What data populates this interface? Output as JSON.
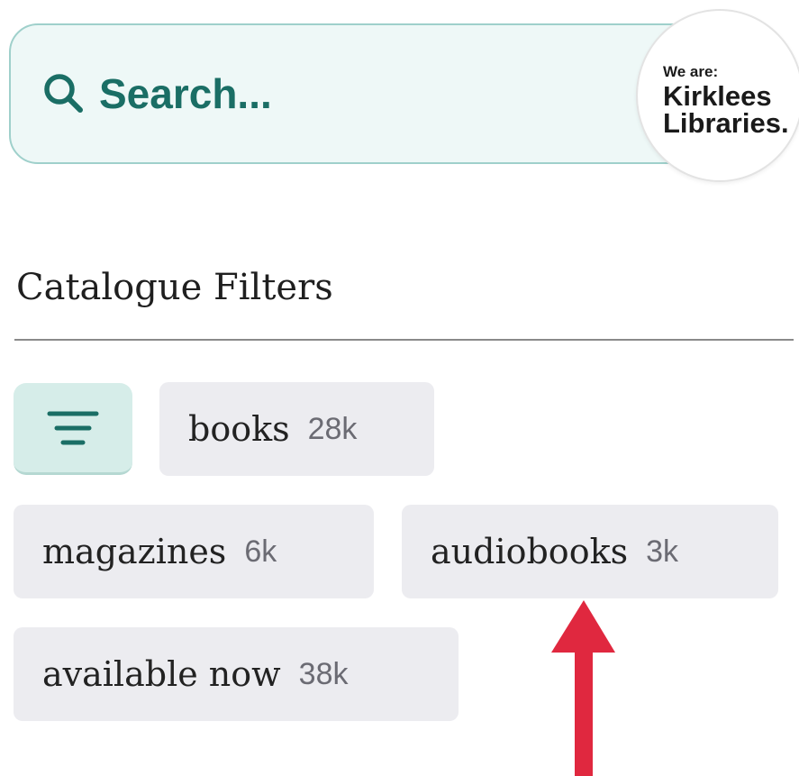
{
  "search": {
    "placeholder": "Search...",
    "icon": "search-icon"
  },
  "logo": {
    "line_small": "We are:",
    "line1": "Kirklees",
    "line2": "Libraries."
  },
  "filters": {
    "title": "Catalogue Filters",
    "toggle_icon": "filter-lines-icon",
    "chips": [
      {
        "label": "books",
        "count": "28k"
      },
      {
        "label": "magazines",
        "count": "6k"
      },
      {
        "label": "audiobooks",
        "count": "3k"
      },
      {
        "label": "available now",
        "count": "38k"
      }
    ]
  },
  "colors": {
    "accent": "#1a6e65",
    "search_bg": "#eef8f7",
    "search_border": "#9fd0cb",
    "chip_bg": "#ececf0",
    "toggle_bg": "#d6ede9",
    "annotation_arrow": "#e0283f"
  }
}
